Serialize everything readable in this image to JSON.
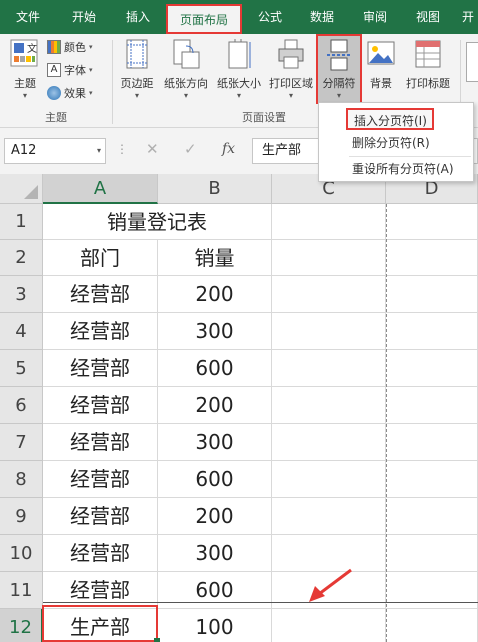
{
  "tabs": [
    {
      "label": "文件",
      "active": false
    },
    {
      "label": "开始",
      "active": false
    },
    {
      "label": "插入",
      "active": false
    },
    {
      "label": "页面布局",
      "active": true
    },
    {
      "label": "公式",
      "active": false
    },
    {
      "label": "数据",
      "active": false
    },
    {
      "label": "审阅",
      "active": false
    },
    {
      "label": "视图",
      "active": false
    },
    {
      "label": "开",
      "active": false
    }
  ],
  "ribbon": {
    "theme_group": {
      "themes_label": "主题",
      "colors_label": "颜色",
      "fonts_label": "字体",
      "effects_label": "效果",
      "group_label": "主题"
    },
    "page_setup_group": {
      "margins_label": "页边距",
      "orientation_label": "纸张方向",
      "size_label": "纸张大小",
      "print_area_label": "打印区域",
      "breaks_label": "分隔符",
      "background_label": "背景",
      "print_titles_label": "打印标题",
      "group_label": "页面设置"
    }
  },
  "breaks_menu": {
    "items": [
      {
        "label": "插入分页符(I)",
        "highlighted": true
      },
      {
        "label": "删除分页符(R)",
        "highlighted": false
      },
      {
        "label": "重设所有分页符(A)",
        "highlighted": false
      }
    ]
  },
  "formula_bar": {
    "name_box": "A12",
    "fx_label": "fx",
    "content": "生产部"
  },
  "sheet": {
    "columns": [
      "A",
      "B",
      "C",
      "D"
    ],
    "rows": [
      {
        "num": "1",
        "a": "销量登记表",
        "b": ""
      },
      {
        "num": "2",
        "a": "部门",
        "b": "销量"
      },
      {
        "num": "3",
        "a": "经营部",
        "b": "200"
      },
      {
        "num": "4",
        "a": "经营部",
        "b": "300"
      },
      {
        "num": "5",
        "a": "经营部",
        "b": "600"
      },
      {
        "num": "6",
        "a": "经营部",
        "b": "200"
      },
      {
        "num": "7",
        "a": "经营部",
        "b": "300"
      },
      {
        "num": "8",
        "a": "经营部",
        "b": "600"
      },
      {
        "num": "9",
        "a": "经营部",
        "b": "200"
      },
      {
        "num": "10",
        "a": "经营部",
        "b": "300"
      },
      {
        "num": "11",
        "a": "经营部",
        "b": "600"
      },
      {
        "num": "12",
        "a": "生产部",
        "b": "100"
      }
    ],
    "selected_cell": "A12"
  },
  "colors": {
    "excel_green": "#217346",
    "highlight_red": "#e53935",
    "arrow_red": "#e53935"
  }
}
